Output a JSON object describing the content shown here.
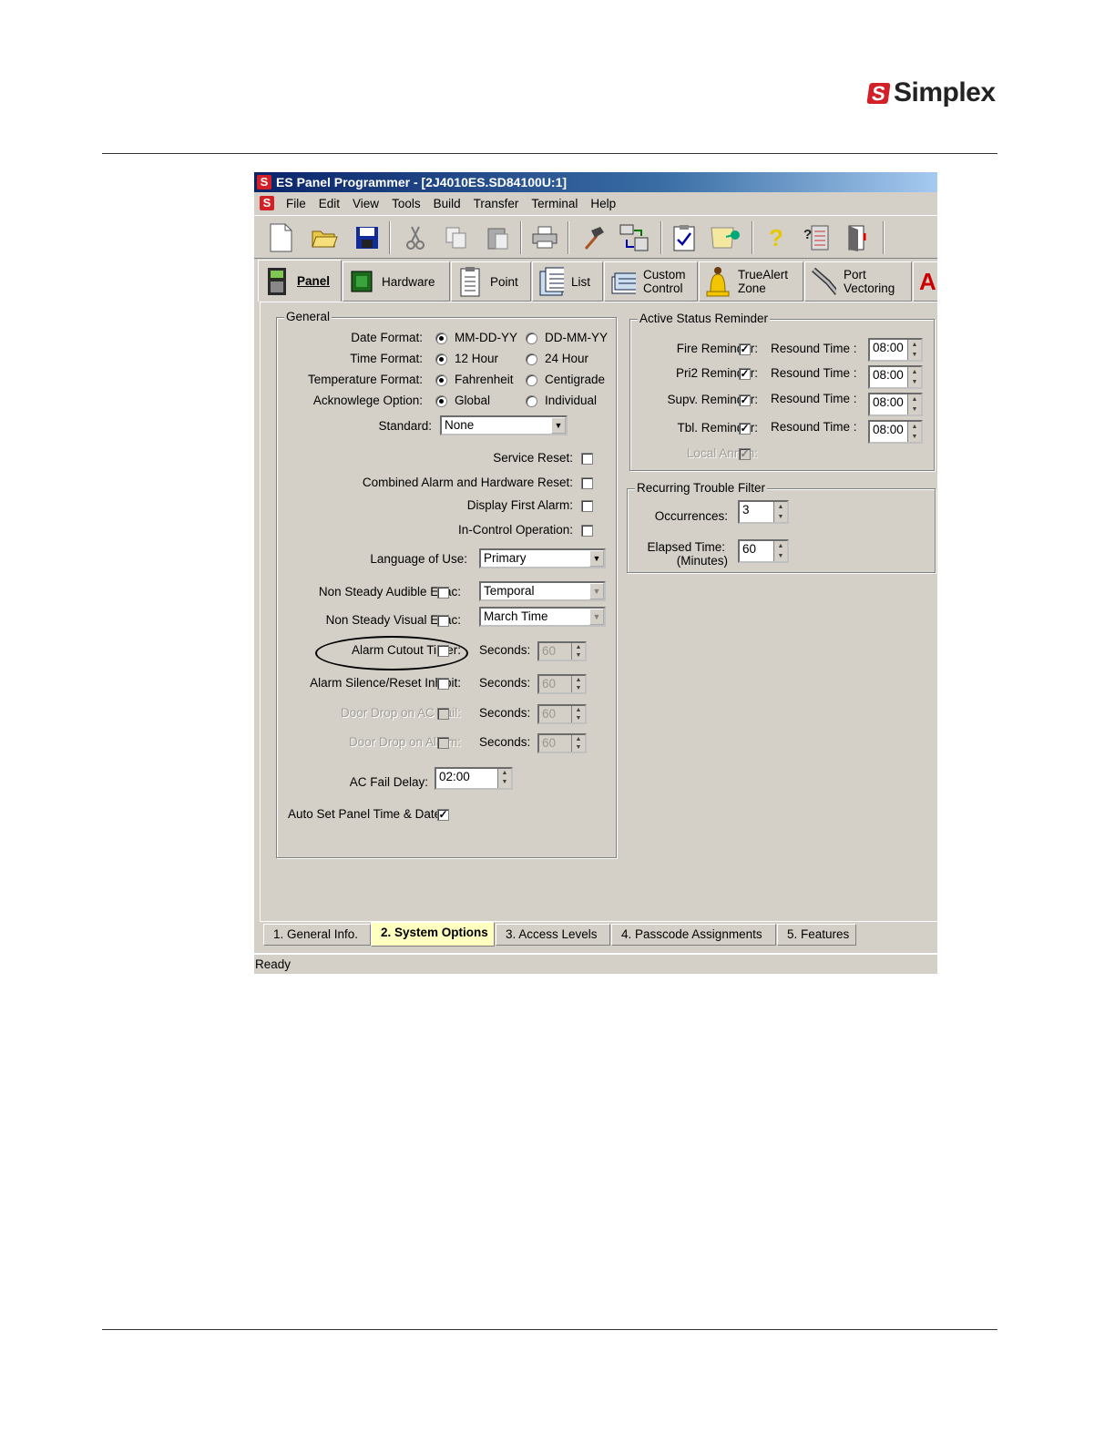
{
  "brand": {
    "logo_mark": "S",
    "name": "Simplex"
  },
  "window": {
    "title": "ES Panel Programmer - [2J4010ES.SD84100U:1]",
    "app_icon": "S"
  },
  "menu": [
    "File",
    "Edit",
    "View",
    "Tools",
    "Build",
    "Transfer",
    "Terminal",
    "Help"
  ],
  "toolbar_icons": [
    "new-file-icon",
    "open-folder-icon",
    "save-icon",
    "cut-icon",
    "copy-icon",
    "paste-icon",
    "print-icon",
    "build-icon",
    "transfer-icon",
    "checklist-icon",
    "pin-icon",
    "help-icon",
    "query-help-icon",
    "exit-icon"
  ],
  "top_tabs": [
    {
      "label": "Panel",
      "icon": "panel-icon"
    },
    {
      "label": "Hardware",
      "icon": "hardware-icon"
    },
    {
      "label": "Point",
      "icon": "point-icon"
    },
    {
      "label": "List",
      "icon": "list-icon"
    },
    {
      "label": "Custom\nControl",
      "icon": "custom-control-icon"
    },
    {
      "label": "TrueAlert\nZone",
      "icon": "bell-icon"
    },
    {
      "label": "Port\nVectoring",
      "icon": "port-vectoring-icon"
    }
  ],
  "general": {
    "title": "General",
    "date_format": {
      "label": "Date Format:",
      "opt1": "MM-DD-YY",
      "opt2": "DD-MM-YY",
      "selected": "MM-DD-YY"
    },
    "time_format": {
      "label": "Time Format:",
      "opt1": "12 Hour",
      "opt2": "24 Hour",
      "selected": "12 Hour"
    },
    "temperature_format": {
      "label": "Temperature Format:",
      "opt1": "Fahrenheit",
      "opt2": "Centigrade",
      "selected": "Fahrenheit"
    },
    "acknowledge_option": {
      "label": "Acknowlege Option:",
      "opt1": "Global",
      "opt2": "Individual",
      "selected": "Global"
    },
    "standard": {
      "label": "Standard:",
      "value": "None"
    },
    "service_reset": {
      "label": "Service Reset:",
      "checked": false
    },
    "combined_reset": {
      "label": "Combined Alarm and Hardware Reset:",
      "checked": false
    },
    "display_first_alarm": {
      "label": "Display First Alarm:",
      "checked": false
    },
    "in_control_operation": {
      "label": "In-Control Operation:",
      "checked": false
    },
    "language": {
      "label": "Language of Use:",
      "value": "Primary"
    },
    "audible_evac": {
      "label": "Non Steady Audible Evac:",
      "checked": false,
      "value": "Temporal"
    },
    "visual_evac": {
      "label": "Non Steady Visual Evac:",
      "checked": false,
      "value": "March Time"
    },
    "alarm_cutout": {
      "label": "Alarm Cutout Timer:",
      "checked": false,
      "seconds_label": "Seconds:",
      "seconds": "60"
    },
    "silence_inhibit": {
      "label": "Alarm Silence/Reset Inhibit:",
      "checked": false,
      "seconds_label": "Seconds:",
      "seconds": "60"
    },
    "door_drop_ac": {
      "label": "Door Drop on AC Fail:",
      "checked": false,
      "seconds_label": "Seconds:",
      "seconds": "60"
    },
    "door_drop_alarm": {
      "label": "Door Drop on Alarm:",
      "checked": false,
      "seconds_label": "Seconds:",
      "seconds": "60"
    },
    "ac_fail_delay": {
      "label": "AC Fail Delay:",
      "value": "02:00"
    },
    "auto_set_time": {
      "label": "Auto Set Panel Time & Date",
      "checked": true
    }
  },
  "active_status": {
    "title": "Active Status Reminder",
    "resound_label": "Resound Time :",
    "rows": [
      {
        "label": "Fire Reminder:",
        "checked": true,
        "time": "08:00"
      },
      {
        "label": "Pri2 Reminder:",
        "checked": true,
        "time": "08:00"
      },
      {
        "label": "Supv. Reminder:",
        "checked": true,
        "time": "08:00"
      },
      {
        "label": "Tbl. Reminder:",
        "checked": true,
        "time": "08:00"
      }
    ],
    "local_annun": {
      "label": "Local Annun:",
      "checked": true
    }
  },
  "trouble_filter": {
    "title": "Recurring Trouble Filter",
    "occurrences": {
      "label": "Occurrences:",
      "value": "3"
    },
    "elapsed": {
      "label": "Elapsed Time:",
      "sublabel": "(Minutes)",
      "value": "60"
    }
  },
  "bottom_tabs": [
    "1. General Info.",
    "2. System Options",
    "3. Access Levels",
    "4. Passcode Assignments",
    "5. Features"
  ],
  "active_bottom_tab": "2. System Options",
  "status": "Ready",
  "colors": {
    "brand_red": "#d31f26",
    "title_blue": "#0a246a",
    "face": "#d4d0c8",
    "active_tab": "#ffffc0"
  }
}
